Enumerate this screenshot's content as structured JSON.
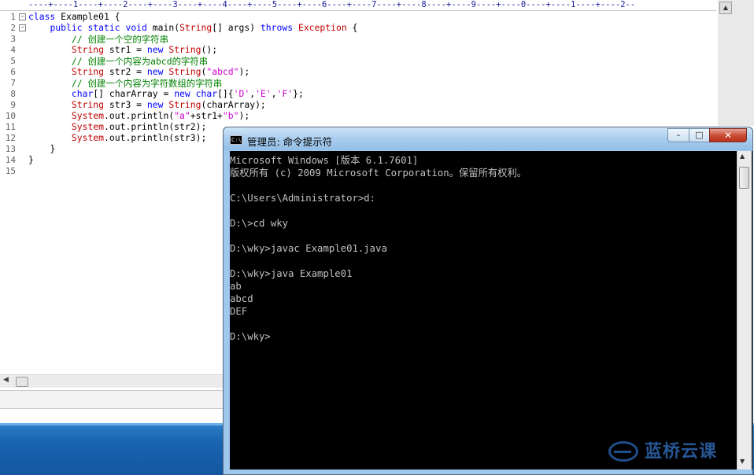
{
  "editor": {
    "ruler": "----+----1----+----2----+----3----+----4----+----5----+----6----+----7----+----8----+----9----+----0----+----1----+----2--",
    "line_numbers": [
      "1",
      "2",
      "3",
      "4",
      "5",
      "6",
      "7",
      "8",
      "9",
      "10",
      "11",
      "12",
      "13",
      "14",
      "15"
    ],
    "code": [
      {
        "indent": "",
        "tokens": [
          {
            "t": "kw",
            "v": "class"
          },
          {
            "t": "pl",
            "v": " Example01 {"
          }
        ]
      },
      {
        "indent": "    ",
        "tokens": [
          {
            "t": "kw",
            "v": "public"
          },
          {
            "t": "pl",
            "v": " "
          },
          {
            "t": "kw",
            "v": "static"
          },
          {
            "t": "pl",
            "v": " "
          },
          {
            "t": "kw",
            "v": "void"
          },
          {
            "t": "pl",
            "v": " main("
          },
          {
            "t": "ty",
            "v": "String"
          },
          {
            "t": "pl",
            "v": "[] args) "
          },
          {
            "t": "kw",
            "v": "throws"
          },
          {
            "t": "pl",
            "v": " "
          },
          {
            "t": "ty",
            "v": "Exception"
          },
          {
            "t": "pl",
            "v": " {"
          }
        ]
      },
      {
        "indent": "        ",
        "tokens": [
          {
            "t": "cm",
            "v": "// 创建一个空的字符串"
          }
        ]
      },
      {
        "indent": "        ",
        "tokens": [
          {
            "t": "ty",
            "v": "String"
          },
          {
            "t": "pl",
            "v": " str1 = "
          },
          {
            "t": "kw",
            "v": "new"
          },
          {
            "t": "pl",
            "v": " "
          },
          {
            "t": "ty",
            "v": "String"
          },
          {
            "t": "pl",
            "v": "();"
          }
        ]
      },
      {
        "indent": "        ",
        "tokens": [
          {
            "t": "cm",
            "v": "// 创建一个内容为abcd的字符串"
          }
        ]
      },
      {
        "indent": "        ",
        "tokens": [
          {
            "t": "ty",
            "v": "String"
          },
          {
            "t": "pl",
            "v": " str2 = "
          },
          {
            "t": "kw",
            "v": "new"
          },
          {
            "t": "pl",
            "v": " "
          },
          {
            "t": "ty",
            "v": "String"
          },
          {
            "t": "pl",
            "v": "("
          },
          {
            "t": "st",
            "v": "\"abcd\""
          },
          {
            "t": "pl",
            "v": ");"
          }
        ]
      },
      {
        "indent": "        ",
        "tokens": [
          {
            "t": "cm",
            "v": "// 创建一个内容为字符数组的字符串"
          }
        ]
      },
      {
        "indent": "        ",
        "tokens": [
          {
            "t": "kw",
            "v": "char"
          },
          {
            "t": "pl",
            "v": "[] charArray = "
          },
          {
            "t": "kw",
            "v": "new"
          },
          {
            "t": "pl",
            "v": " "
          },
          {
            "t": "kw",
            "v": "char"
          },
          {
            "t": "pl",
            "v": "[]{"
          },
          {
            "t": "st",
            "v": "'D'"
          },
          {
            "t": "pl",
            "v": ","
          },
          {
            "t": "st",
            "v": "'E'"
          },
          {
            "t": "pl",
            "v": ","
          },
          {
            "t": "st",
            "v": "'F'"
          },
          {
            "t": "pl",
            "v": "};"
          }
        ]
      },
      {
        "indent": "        ",
        "tokens": [
          {
            "t": "ty",
            "v": "String"
          },
          {
            "t": "pl",
            "v": " str3 = "
          },
          {
            "t": "kw",
            "v": "new"
          },
          {
            "t": "pl",
            "v": " "
          },
          {
            "t": "ty",
            "v": "String"
          },
          {
            "t": "pl",
            "v": "(charArray);"
          }
        ]
      },
      {
        "indent": "        ",
        "tokens": [
          {
            "t": "ty",
            "v": "System"
          },
          {
            "t": "pl",
            "v": ".out.println("
          },
          {
            "t": "st",
            "v": "\"a\""
          },
          {
            "t": "pl",
            "v": "+str1+"
          },
          {
            "t": "st",
            "v": "\"b\""
          },
          {
            "t": "pl",
            "v": ");"
          }
        ]
      },
      {
        "indent": "        ",
        "tokens": [
          {
            "t": "ty",
            "v": "System"
          },
          {
            "t": "pl",
            "v": ".out.println(str2);"
          }
        ]
      },
      {
        "indent": "        ",
        "tokens": [
          {
            "t": "ty",
            "v": "System"
          },
          {
            "t": "pl",
            "v": ".out.println(str3);"
          }
        ]
      },
      {
        "indent": "    ",
        "tokens": [
          {
            "t": "pl",
            "v": "}"
          }
        ]
      },
      {
        "indent": "",
        "tokens": [
          {
            "t": "pl",
            "v": "}"
          }
        ]
      },
      {
        "indent": "",
        "tokens": []
      }
    ],
    "colors": {
      "keyword": "#0000ff",
      "type": "#c00000",
      "string": "#cc00cc",
      "comment": "#008000"
    }
  },
  "cmd": {
    "title": "管理员: 命令提示符",
    "icon_label": "C:\\",
    "lines": [
      "Microsoft Windows [版本 6.1.7601]",
      "版权所有 (c) 2009 Microsoft Corporation。保留所有权利。",
      "",
      "C:\\Users\\Administrator>d:",
      "",
      "D:\\>cd wky",
      "",
      "D:\\wky>javac Example01.java",
      "",
      "D:\\wky>java Example01",
      "ab",
      "abcd",
      "DEF",
      "",
      "D:\\wky>"
    ],
    "buttons": {
      "minimize": "–",
      "maximize": "□",
      "close": "✕"
    }
  },
  "watermark": {
    "text": "蓝桥云课"
  }
}
